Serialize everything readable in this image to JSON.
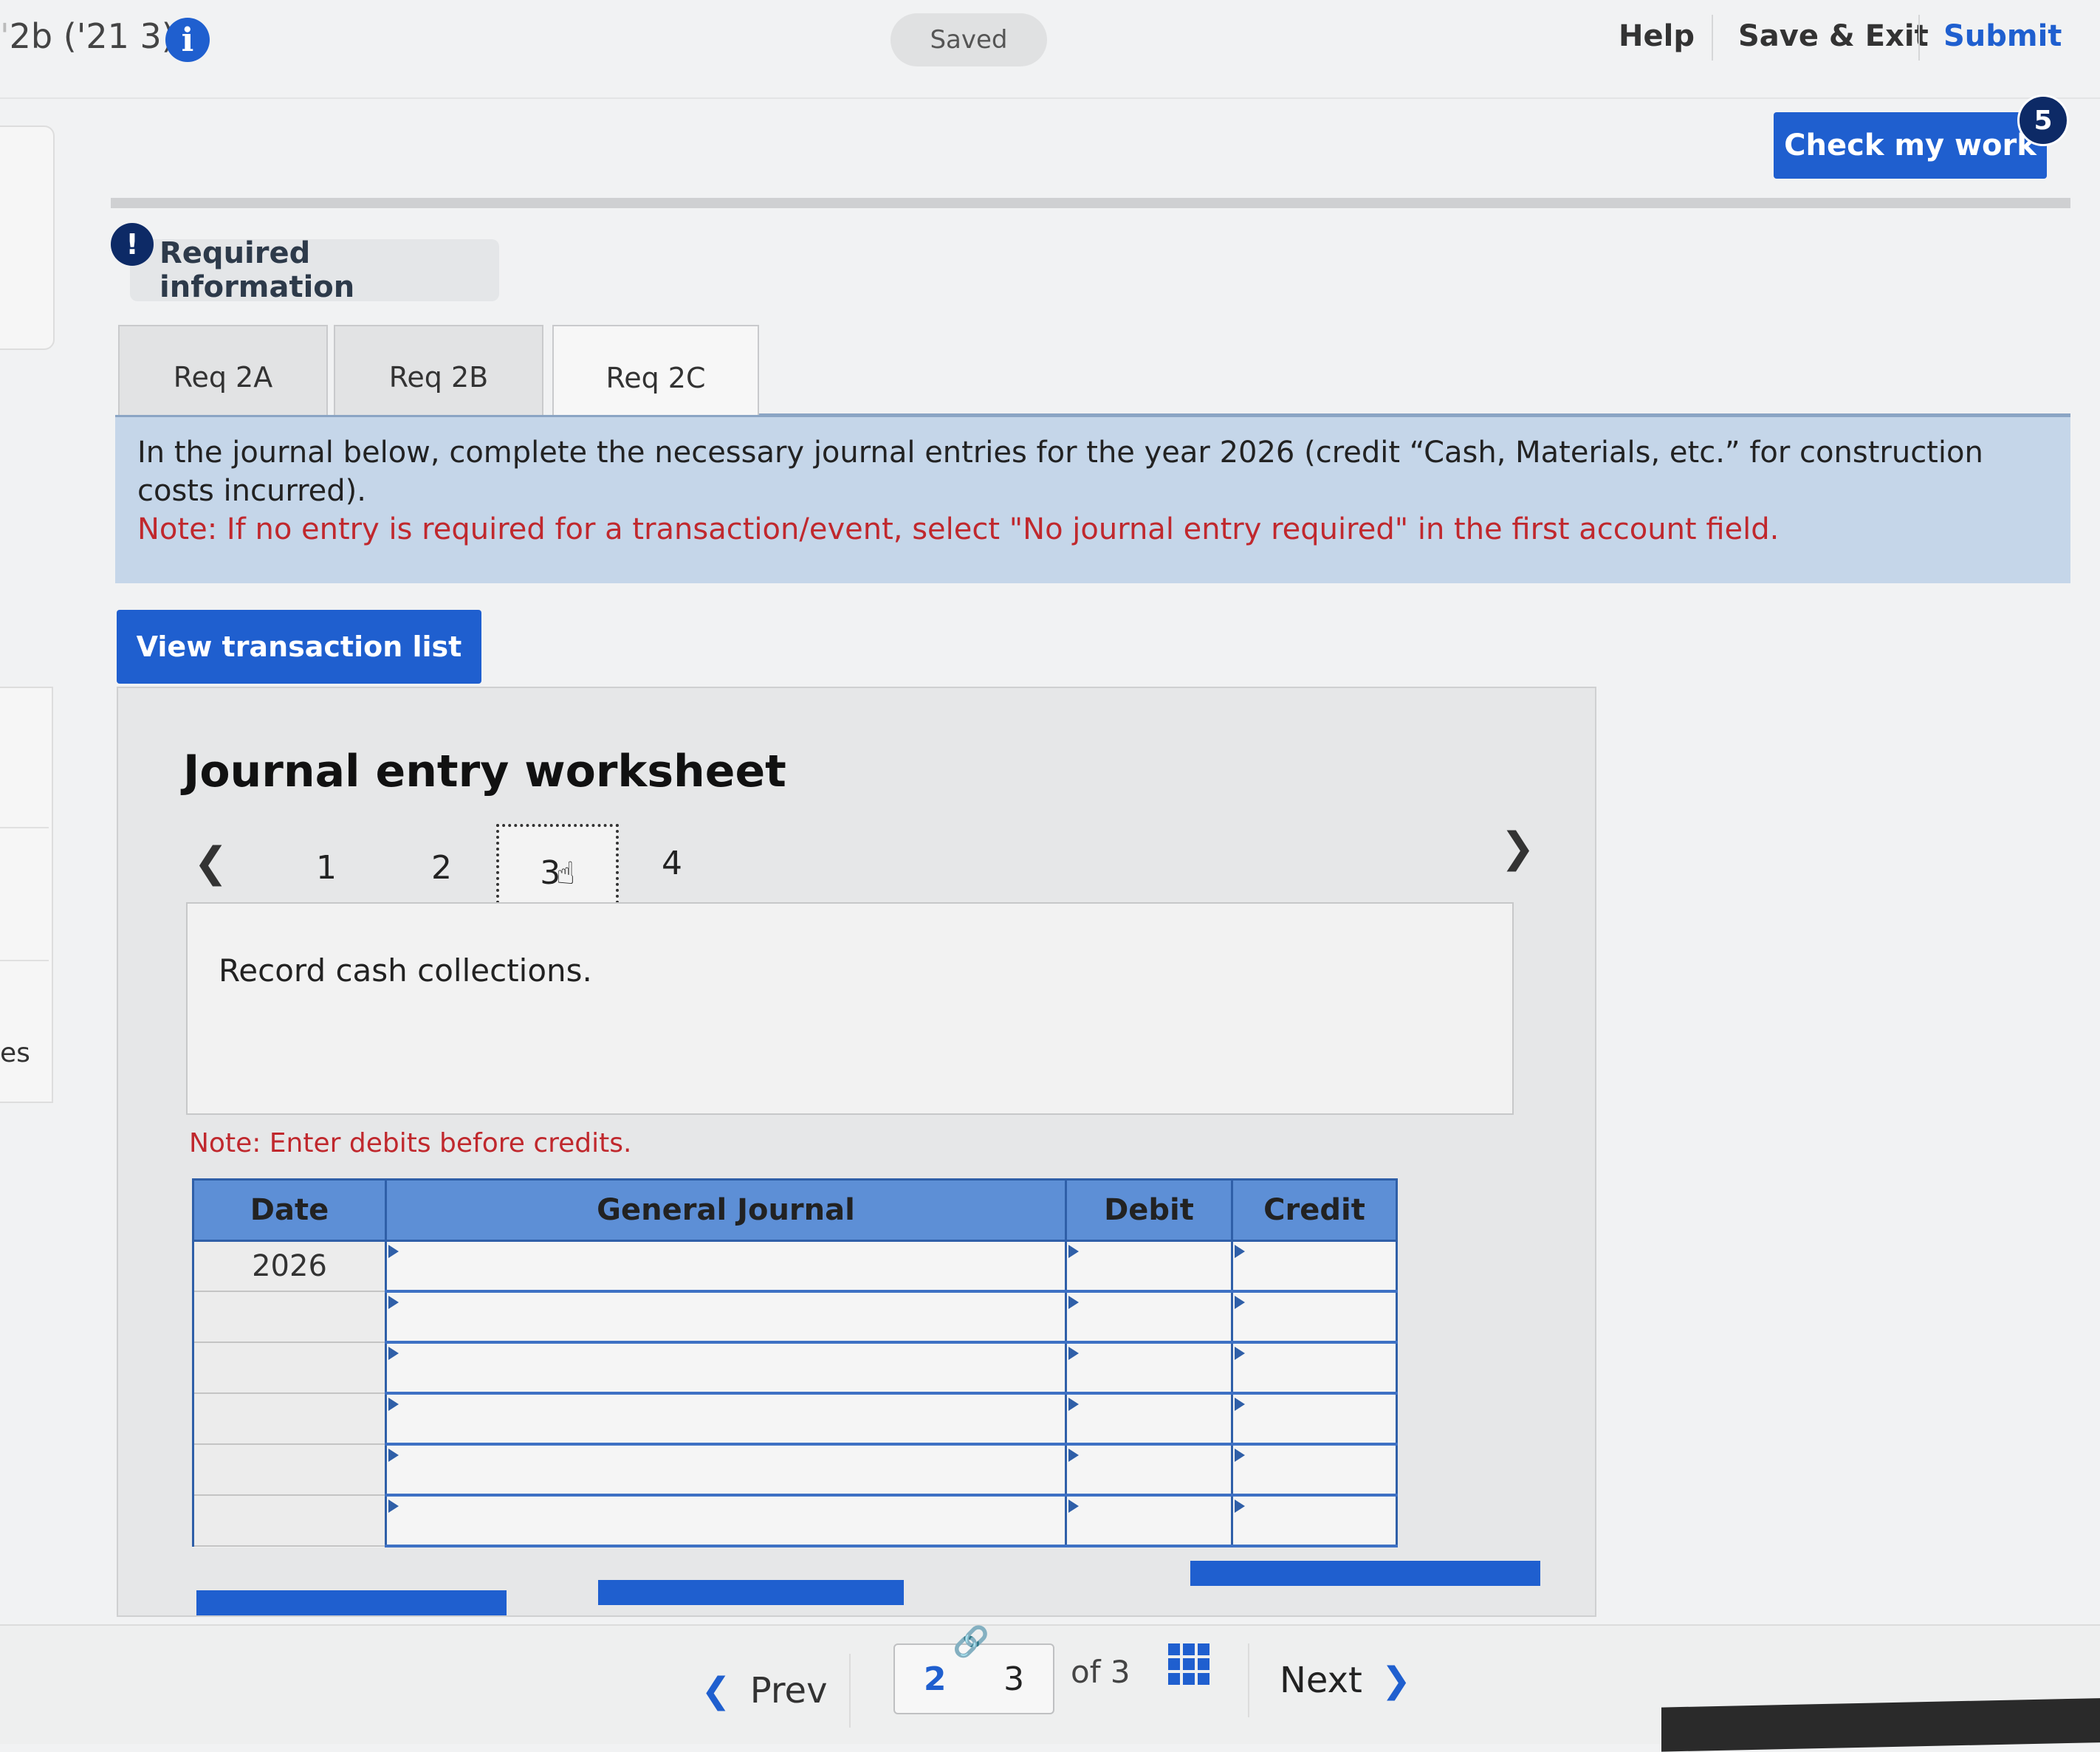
{
  "header": {
    "title_prefix": "'",
    "title": "2b ('21 3)",
    "saved_label": "Saved",
    "help_label": "Help",
    "save_exit_label": "Save & Exit",
    "submit_label": "Submit"
  },
  "check_work": {
    "label": "Check my work",
    "badge": "5"
  },
  "left_panel": {
    "cut_text": "es"
  },
  "required_info": {
    "label": "Required information",
    "icon": "!"
  },
  "tabs": [
    {
      "label": "Req 2A"
    },
    {
      "label": "Req 2B"
    },
    {
      "label": "Req 2C",
      "active": true
    }
  ],
  "instructions": {
    "text": "In the journal below, complete the necessary journal entries for the year 2026 (credit “Cash, Materials, etc.” for construction costs incurred).",
    "note": "Note: If no entry is required for a transaction/event, select \"No journal entry required\" in the first account field."
  },
  "view_transactions_label": "View transaction list",
  "worksheet": {
    "title": "Journal entry worksheet",
    "pages": [
      "1",
      "2",
      "3",
      "4"
    ],
    "current_page": "3",
    "description": "Record cash collections.",
    "debit_note": "Note: Enter debits before credits."
  },
  "journal": {
    "headers": {
      "date": "Date",
      "general_journal": "General Journal",
      "debit": "Debit",
      "credit": "Credit"
    },
    "rows": [
      {
        "date": "2026",
        "account": "",
        "debit": "",
        "credit": ""
      },
      {
        "date": "",
        "account": "",
        "debit": "",
        "credit": ""
      },
      {
        "date": "",
        "account": "",
        "debit": "",
        "credit": ""
      },
      {
        "date": "",
        "account": "",
        "debit": "",
        "credit": ""
      },
      {
        "date": "",
        "account": "",
        "debit": "",
        "credit": ""
      },
      {
        "date": "",
        "account": "",
        "debit": "",
        "credit": ""
      }
    ]
  },
  "bottom_nav": {
    "prev_label": "Prev",
    "next_label": "Next",
    "page_current": "2",
    "page_next": "3",
    "of_text": "of 3"
  },
  "colors": {
    "accent": "#1f5fcf",
    "table_header": "#5d8fd6",
    "note_red": "#c0282d",
    "instruction_bg": "#c5d6e9"
  },
  "icons": {
    "info": "info-icon",
    "alert": "alert-icon",
    "prev": "chevron-left-icon",
    "next": "chevron-right-icon",
    "grid": "grid-icon",
    "link": "link-icon",
    "cursor": "hand-cursor-icon"
  }
}
